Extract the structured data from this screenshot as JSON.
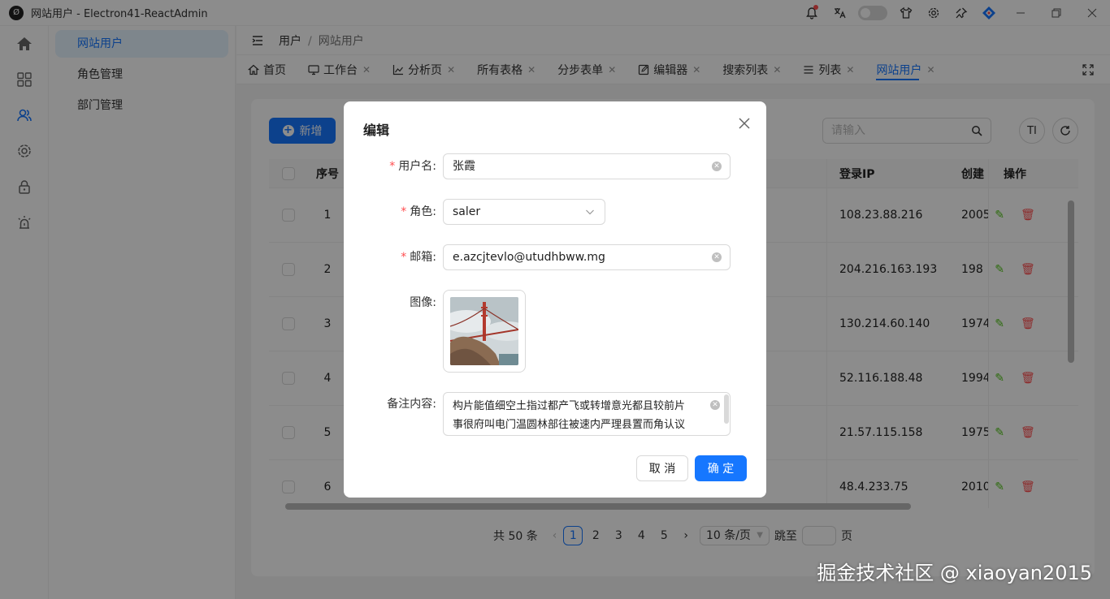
{
  "window": {
    "title": "网站用户 - Electron41-ReactAdmin",
    "logo_text": "Ø"
  },
  "submenu": {
    "items": [
      {
        "label": "网站用户",
        "active": true
      },
      {
        "label": "角色管理",
        "active": false
      },
      {
        "label": "部门管理",
        "active": false
      }
    ]
  },
  "breadcrumb": {
    "root": "用户",
    "sep": "/",
    "current": "网站用户"
  },
  "tabs": [
    {
      "label": "首页",
      "icon": "home-icon",
      "closable": false
    },
    {
      "label": "工作台",
      "icon": "monitor-icon",
      "closable": true
    },
    {
      "label": "分析页",
      "icon": "chart-icon",
      "closable": true
    },
    {
      "label": "所有表格",
      "icon": "",
      "closable": true
    },
    {
      "label": "分步表单",
      "icon": "",
      "closable": true
    },
    {
      "label": "编辑器",
      "icon": "edit-icon",
      "closable": true
    },
    {
      "label": "搜索列表",
      "icon": "",
      "closable": true
    },
    {
      "label": "列表",
      "icon": "list-icon",
      "closable": true
    },
    {
      "label": "网站用户",
      "icon": "",
      "closable": true,
      "active": true
    }
  ],
  "toolbar": {
    "add_label": "新增",
    "search_placeholder": "请输入",
    "size_icon_label": "TI"
  },
  "table": {
    "headers": {
      "no": "序号",
      "ip": "登录IP",
      "created": "创建",
      "actions": "操作"
    },
    "rows": [
      {
        "no": "1",
        "ip": "108.23.88.216",
        "created": "2005"
      },
      {
        "no": "2",
        "ip": "204.216.163.193",
        "created": "198"
      },
      {
        "no": "3",
        "ip": "130.214.60.140",
        "created": "1974"
      },
      {
        "no": "4",
        "ip": "52.116.188.48",
        "created": "1994"
      },
      {
        "no": "5",
        "ip": "21.57.115.158",
        "created": "1975"
      },
      {
        "no": "6",
        "ip": "48.4.233.75",
        "created": "2010"
      }
    ]
  },
  "pagination": {
    "total": "共 50 条",
    "pages": [
      "1",
      "2",
      "3",
      "4",
      "5"
    ],
    "current": "1",
    "page_size": "10 条/页",
    "jump_label": "跳至",
    "page_suffix": "页"
  },
  "modal": {
    "title": "编辑",
    "fields": {
      "username_label": "用户名:",
      "username_value": "张霞",
      "role_label": "角色:",
      "role_value": "saler",
      "email_label": "邮箱:",
      "email_value": "e.azcjtevlo@utudhbww.mg",
      "avatar_label": "图像:",
      "note_label": "备注内容:",
      "note_line1": "构片能值细空土指过都产飞或转增意光都且较前片",
      "note_line2": "事很府叫电门温圆林部往被速内严理县置而角认议"
    },
    "cancel_label": "取 消",
    "ok_label": "确 定"
  },
  "watermark": "掘金技术社区 @ xiaoyan2015",
  "colors": {
    "primary": "#1677ff",
    "danger": "#ff4d4f",
    "success": "#52c41a"
  }
}
